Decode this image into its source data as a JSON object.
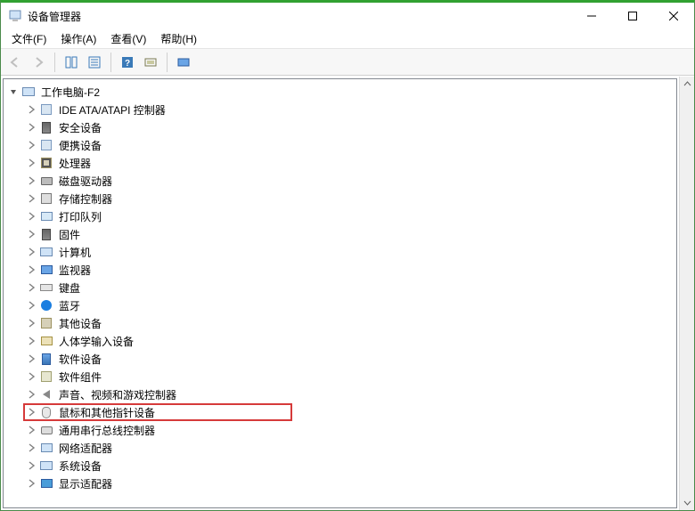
{
  "window": {
    "title": "设备管理器"
  },
  "menus": {
    "file": "文件(F)",
    "action": "操作(A)",
    "view": "查看(V)",
    "help": "帮助(H)"
  },
  "tree": {
    "root": {
      "label": "工作电脑-F2",
      "icon": "computer"
    },
    "items": [
      {
        "label": "IDE ATA/ATAPI 控制器",
        "icon": "generic"
      },
      {
        "label": "安全设备",
        "icon": "firmware"
      },
      {
        "label": "便携设备",
        "icon": "generic"
      },
      {
        "label": "处理器",
        "icon": "chip"
      },
      {
        "label": "磁盘驱动器",
        "icon": "disk"
      },
      {
        "label": "存储控制器",
        "icon": "storage"
      },
      {
        "label": "打印队列",
        "icon": "printer"
      },
      {
        "label": "固件",
        "icon": "firmware"
      },
      {
        "label": "计算机",
        "icon": "sys"
      },
      {
        "label": "监视器",
        "icon": "monitor"
      },
      {
        "label": "键盘",
        "icon": "keyboard"
      },
      {
        "label": "蓝牙",
        "icon": "bt"
      },
      {
        "label": "其他设备",
        "icon": "other"
      },
      {
        "label": "人体学输入设备",
        "icon": "hid"
      },
      {
        "label": "软件设备",
        "icon": "soft"
      },
      {
        "label": "软件组件",
        "icon": "comp"
      },
      {
        "label": "声音、视频和游戏控制器",
        "icon": "sound"
      },
      {
        "label": "鼠标和其他指针设备",
        "icon": "mouse",
        "highlighted": true
      },
      {
        "label": "通用串行总线控制器",
        "icon": "usb"
      },
      {
        "label": "网络适配器",
        "icon": "net"
      },
      {
        "label": "系统设备",
        "icon": "sys"
      },
      {
        "label": "显示适配器",
        "icon": "display"
      }
    ]
  },
  "annotation": {
    "highlight_color": "#d63a3a"
  }
}
